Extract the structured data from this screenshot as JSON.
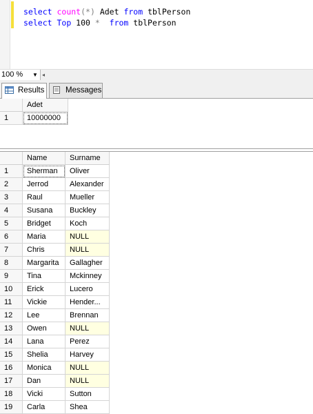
{
  "editor": {
    "line1": {
      "t1": "select",
      "t2": "count",
      "t3": "(*)",
      "t4": " Adet ",
      "t5": "from",
      "t6": " tblPerson"
    },
    "line2": {
      "t1": "select",
      "t2": " Top ",
      "t3": "100 ",
      "t4": "*",
      "t5": "  from",
      "t6": " tblPerson"
    }
  },
  "zoom": {
    "value": "100 %"
  },
  "tabs": {
    "results": "Results",
    "messages": "Messages"
  },
  "grid1": {
    "headers": [
      "Adet"
    ],
    "rows": [
      {
        "num": "1",
        "adet": "10000000"
      }
    ]
  },
  "grid2": {
    "headers": [
      "Name",
      "Surname"
    ],
    "rows": [
      {
        "num": "1",
        "name": "Sherman",
        "surname": "Oliver"
      },
      {
        "num": "2",
        "name": "Jerrod",
        "surname": "Alexander"
      },
      {
        "num": "3",
        "name": "Raul",
        "surname": "Mueller"
      },
      {
        "num": "4",
        "name": "Susana",
        "surname": "Buckley"
      },
      {
        "num": "5",
        "name": "Bridget",
        "surname": "Koch"
      },
      {
        "num": "6",
        "name": "Maria",
        "surname": "NULL"
      },
      {
        "num": "7",
        "name": "Chris",
        "surname": "NULL"
      },
      {
        "num": "8",
        "name": "Margarita",
        "surname": "Gallagher"
      },
      {
        "num": "9",
        "name": "Tina",
        "surname": "Mckinney"
      },
      {
        "num": "10",
        "name": "Erick",
        "surname": "Lucero"
      },
      {
        "num": "11",
        "name": "Vickie",
        "surname": "Hender..."
      },
      {
        "num": "12",
        "name": "Lee",
        "surname": "Brennan"
      },
      {
        "num": "13",
        "name": "Owen",
        "surname": "NULL"
      },
      {
        "num": "14",
        "name": "Lana",
        "surname": "Perez"
      },
      {
        "num": "15",
        "name": "Shelia",
        "surname": "Harvey"
      },
      {
        "num": "16",
        "name": "Monica",
        "surname": "NULL"
      },
      {
        "num": "17",
        "name": "Dan",
        "surname": "NULL"
      },
      {
        "num": "18",
        "name": "Vicki",
        "surname": "Sutton"
      },
      {
        "num": "19",
        "name": "Carla",
        "surname": "Shea"
      }
    ]
  }
}
